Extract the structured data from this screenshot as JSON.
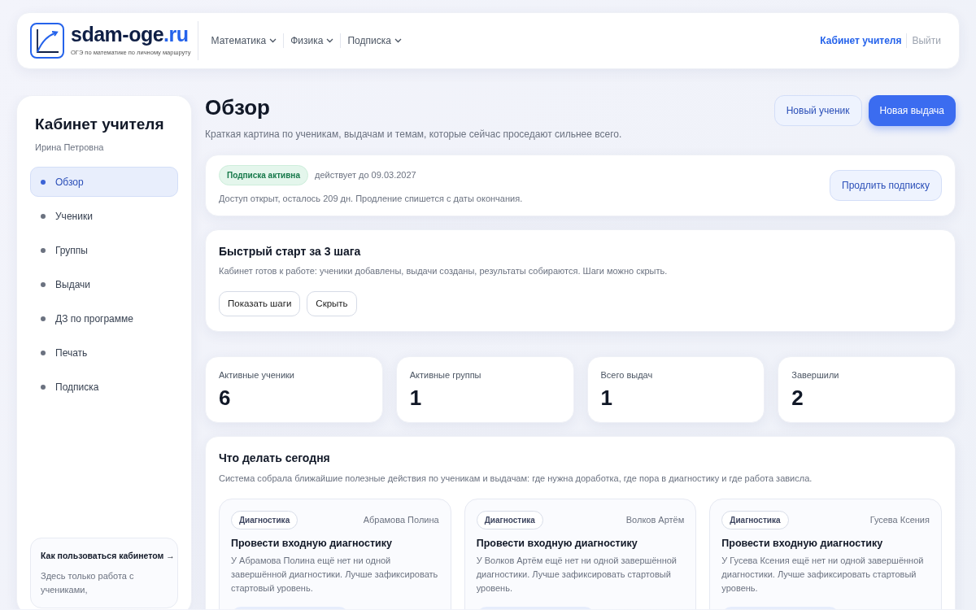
{
  "header": {
    "logo_text": "sdam-oge",
    "logo_tld": ".ru",
    "tagline": "ОГЭ по математике по личному маршруту",
    "menus": [
      {
        "label": "Математика"
      },
      {
        "label": "Физика"
      },
      {
        "label": "Подписка"
      }
    ],
    "account_links": [
      {
        "label": "Кабинет учителя",
        "selected": true
      },
      {
        "label": "Выйти",
        "selected": false
      }
    ]
  },
  "sidebar": {
    "title": "Кабинет учителя",
    "user": "Ирина Петровна",
    "items": [
      {
        "label": "Обзор",
        "selected": true
      },
      {
        "label": "Ученики",
        "selected": false
      },
      {
        "label": "Группы",
        "selected": false
      },
      {
        "label": "Выдачи",
        "selected": false
      },
      {
        "label": "ДЗ по программе",
        "selected": false
      },
      {
        "label": "Печать",
        "selected": false
      },
      {
        "label": "Подписка",
        "selected": false
      }
    ],
    "help": {
      "link": "Как пользоваться кабинетом →",
      "text": "Здесь только работа с учениками,"
    }
  },
  "page": {
    "title": "Обзор",
    "subtitle": "Краткая картина по ученикам, выдачам и темам, которые сейчас проседают сильнее всего.",
    "buttons": [
      {
        "label": "Новый ученик",
        "kind": "outline"
      },
      {
        "label": "Новая выдача",
        "kind": "primary"
      }
    ]
  },
  "subscription": {
    "badge": "Подписка активна",
    "valid_until": "действует до 09.03.2027",
    "note": "Доступ открыт, осталось 209 дн. Продление спишется с даты окончания.",
    "button": "Продлить подписку"
  },
  "quick_start": {
    "title": "Быстрый старт за 3 шага",
    "text": "Кабинет готов к работе: ученики добавлены, выдачи созданы, результаты собираются. Шаги можно скрыть.",
    "buttons": [
      "Показать шаги",
      "Скрыть"
    ]
  },
  "stats": [
    {
      "label": "Активные ученики",
      "value": "6"
    },
    {
      "label": "Активные группы",
      "value": "1"
    },
    {
      "label": "Всего выдач",
      "value": "1"
    },
    {
      "label": "Завершили",
      "value": "2"
    }
  ],
  "today": {
    "title": "Что делать сегодня",
    "text": "Система собрала ближайшие полезные действия по ученикам и выдачам: где нужна доработка, где пора в диагностику и где работа зависла.",
    "tasks": [
      {
        "tag": "Диагностика",
        "student": "Абрамова Полина",
        "title": "Провести входную диагностику",
        "text": "У Абрамова Полина ещё нет ни одной завершённой диагностики. Лучше зафиксировать стартовый уровень."
      },
      {
        "tag": "Диагностика",
        "student": "Волков Артём",
        "title": "Провести входную диагностику",
        "text": "У Волков Артём ещё нет ни одной завершённой диагностики. Лучше зафиксировать стартовый уровень."
      },
      {
        "tag": "Диагностика",
        "student": "Гусева Ксения",
        "title": "Провести входную диагностику",
        "text": "У Гусева Ксения ещё нет ни одной завершённой диагностики. Лучше зафиксировать стартовый уровень."
      }
    ]
  }
}
